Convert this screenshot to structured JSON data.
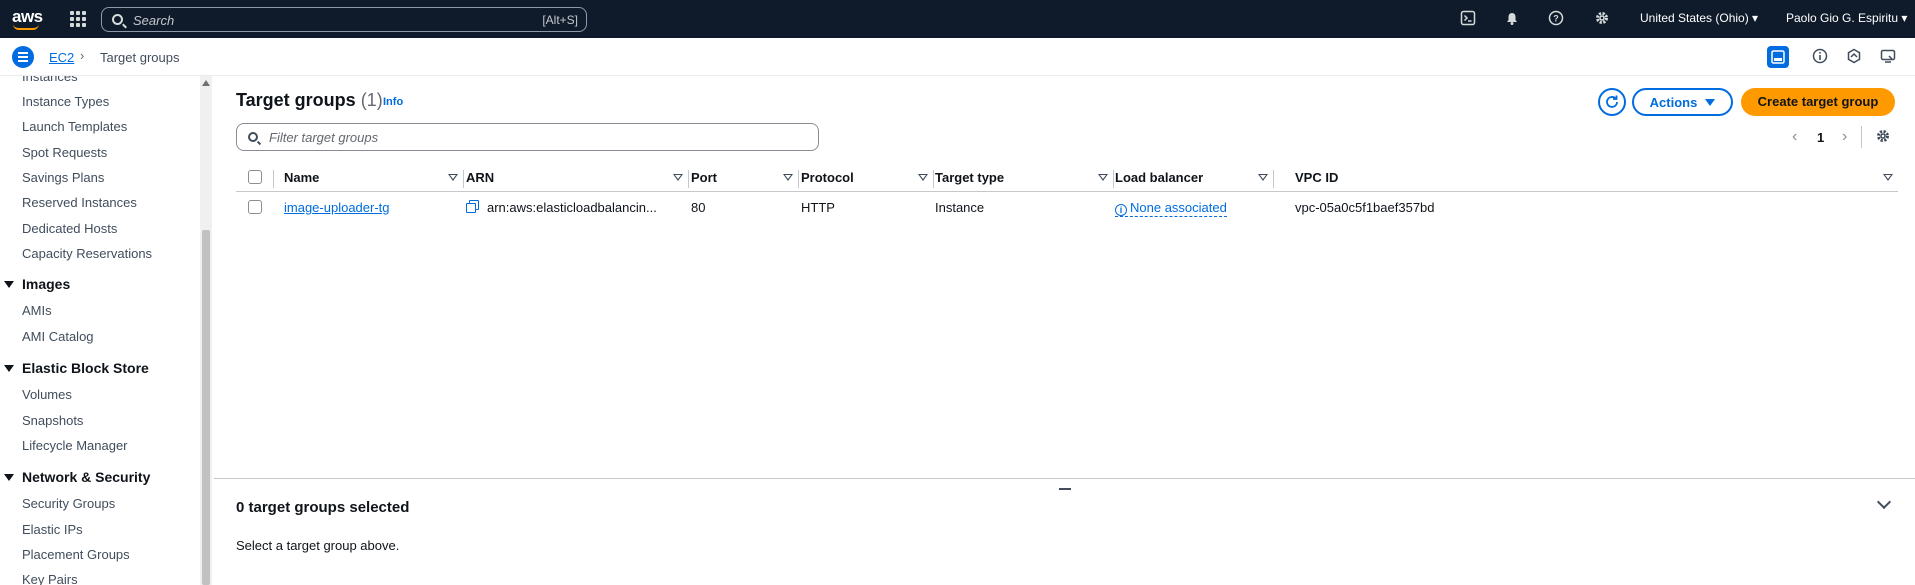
{
  "topnav": {
    "logo": "aws",
    "search_placeholder": "Search",
    "search_shortcut": "[Alt+S]",
    "region": "United States (Ohio) ▾",
    "user": "Paolo Gio G. Espiritu ▾",
    "icons": [
      "cloudshell-icon",
      "bell-icon",
      "help-icon",
      "gear-icon"
    ]
  },
  "breadcrumb": {
    "service": "EC2",
    "separator": "›",
    "current": "Target groups"
  },
  "sidebar": {
    "items_top": [
      "Instances",
      "Instance Types",
      "Launch Templates",
      "Spot Requests",
      "Savings Plans",
      "Reserved Instances",
      "Dedicated Hosts",
      "Capacity Reservations"
    ],
    "images": {
      "heading": "Images",
      "items": [
        "AMIs",
        "AMI Catalog"
      ]
    },
    "ebs": {
      "heading": "Elastic Block Store",
      "items": [
        "Volumes",
        "Snapshots",
        "Lifecycle Manager"
      ]
    },
    "network": {
      "heading": "Network & Security",
      "items": [
        "Security Groups",
        "Elastic IPs",
        "Placement Groups",
        "Key Pairs"
      ]
    }
  },
  "main": {
    "title": "Target groups",
    "count": "(1)",
    "info": "Info",
    "actions_label": "Actions",
    "create_label": "Create target group",
    "filter_placeholder": "Filter target groups",
    "page_number": "1",
    "columns": [
      "Name",
      "ARN",
      "Port",
      "Protocol",
      "Target type",
      "Load balancer",
      "VPC ID"
    ],
    "rows": [
      {
        "name": "image-uploader-tg",
        "arn": "arn:aws:elasticloadbalancin...",
        "port": "80",
        "protocol": "HTTP",
        "target_type": "Instance",
        "load_balancer": "None associated",
        "vpc_id": "vpc-05a0c5f1baef357bd"
      }
    ]
  },
  "split_panel": {
    "title": "0 target groups selected",
    "text": "Select a target group above."
  },
  "colors": {
    "nav_bg": "#0f1b2a",
    "link_blue": "#006ce0",
    "primary_orange": "#ff9900"
  }
}
